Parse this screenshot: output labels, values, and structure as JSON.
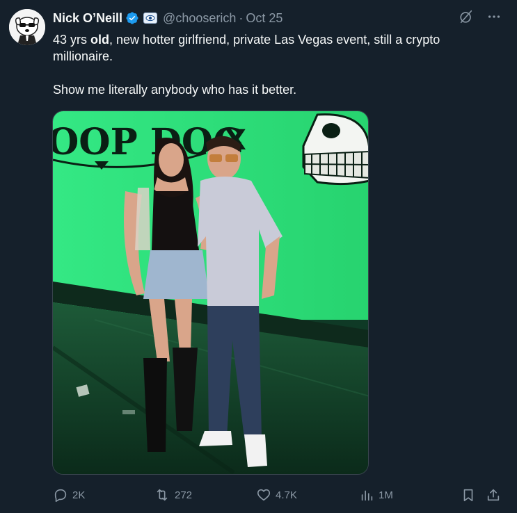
{
  "author": {
    "name": "Nick O’Neill",
    "handle": "@chooserich",
    "separator": "·",
    "date": "Oct 25",
    "verified_icon": "verified-badge-icon",
    "affiliation_icon": "affiliate-eye-badge-icon",
    "avatar_icon": "cartoon-dog-sunglasses-avatar"
  },
  "tweet": {
    "line1_pre": "43 yrs ",
    "line1_bold": "old",
    "line1_post": ", new hotter girlfriend, private Las Vegas event, still a crypto millionaire.",
    "line2": "Show me literally anybody who has it better."
  },
  "media": {
    "alt_icon": "photo-couple-at-event",
    "backdrop_text": "OOP DOG",
    "backdrop_x": "X"
  },
  "actions": {
    "replies": "2K",
    "reposts": "272",
    "likes": "4.7K",
    "views": "1M"
  },
  "colors": {
    "background": "#15202b",
    "text": "#f7f9f9",
    "secondary": "#8b98a5",
    "verified": "#1d9bf0",
    "border": "#38444d",
    "backdrop_green": "#2fe07d"
  }
}
